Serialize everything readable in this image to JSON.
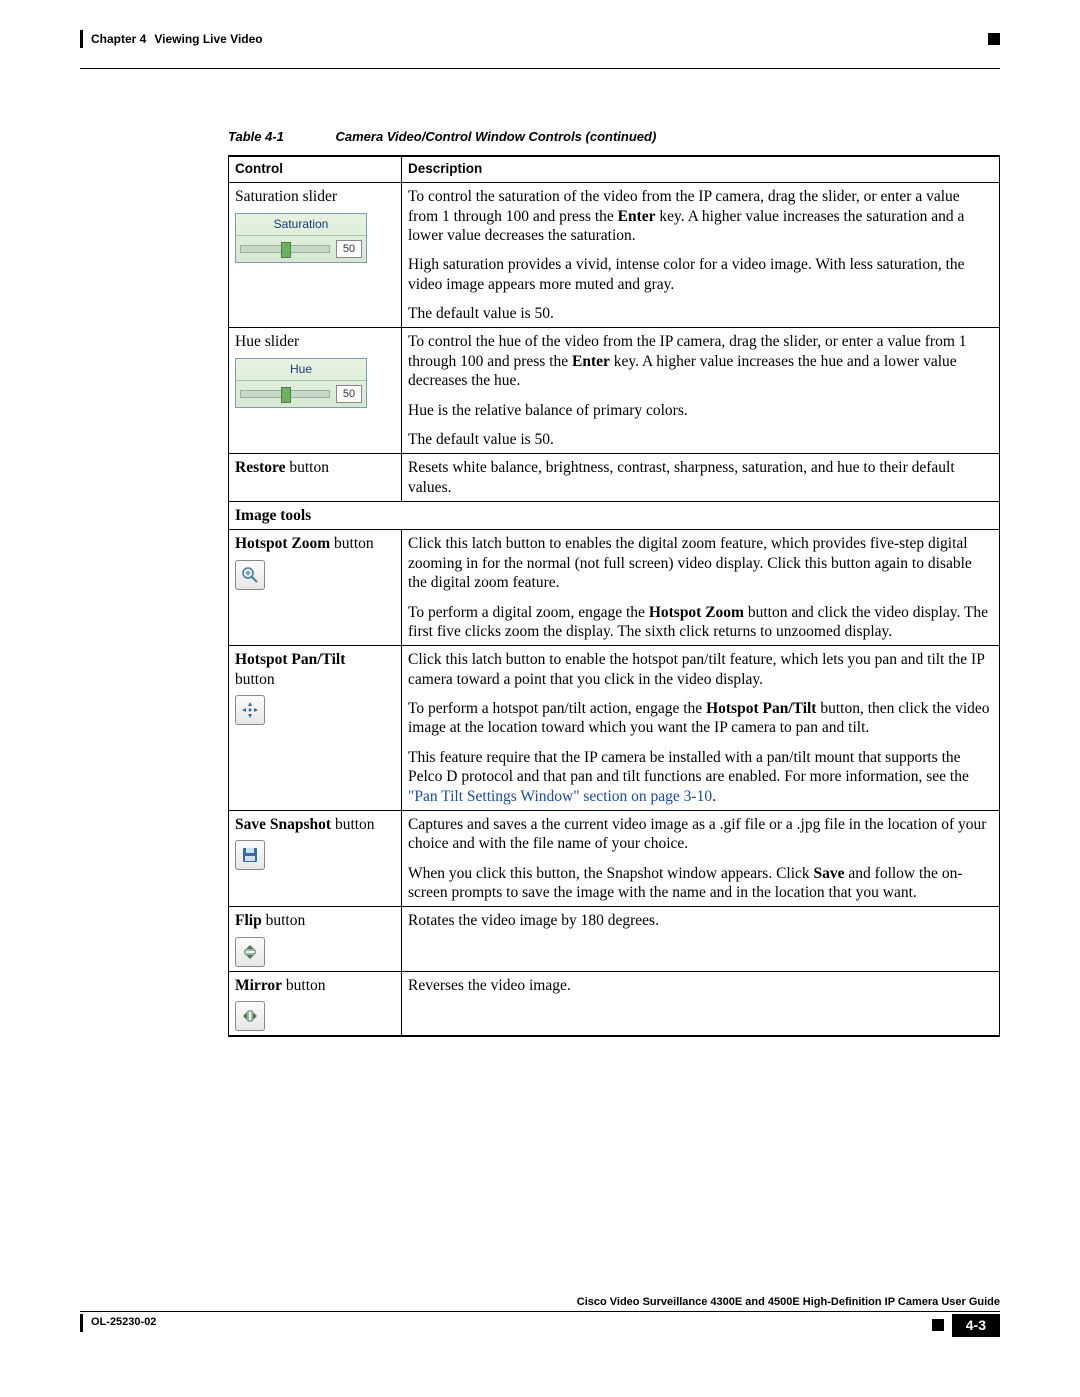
{
  "header": {
    "chapter": "Chapter 4",
    "title": "Viewing Live Video"
  },
  "table": {
    "caption_num": "Table 4-1",
    "caption_text": "Camera Video/Control Window Controls (continued)",
    "col1": "Control",
    "col2": "Description"
  },
  "rows": {
    "saturation": {
      "label": "Saturation slider",
      "widget_title": "Saturation",
      "widget_value": "50",
      "p1a": "To control the saturation of the video from the IP camera, drag the slider, or enter a value from 1 through 100 and press the ",
      "p1b": "Enter",
      "p1c": " key. A higher value increases the saturation and a lower value decreases the saturation.",
      "p2": "High saturation provides a vivid, intense color for a video image. With less saturation, the video image appears more muted and gray.",
      "p3": "The default value is 50."
    },
    "hue": {
      "label": "Hue slider",
      "widget_title": "Hue",
      "widget_value": "50",
      "p1a": "To control the hue of the video from the IP camera, drag the slider, or enter a value from 1 through 100 and press the ",
      "p1b": "Enter",
      "p1c": " key. A higher value increases the hue and a lower value decreases the hue.",
      "p2": "Hue is the relative balance of primary colors.",
      "p3": "The default value is 50."
    },
    "restore": {
      "label_b": "Restore",
      "label_r": " button",
      "p1": "Resets white balance, brightness, contrast, sharpness, saturation, and hue to their default values."
    },
    "section_image_tools": "Image tools",
    "hotspot_zoom": {
      "label_b": "Hotspot Zoom",
      "label_r": " button",
      "p1": "Click this latch button to enables the digital zoom feature, which provides five-step digital zooming in for the normal (not full screen) video display. Click this button again to disable the digital zoom feature.",
      "p2a": "To perform a digital zoom, engage the ",
      "p2b": "Hotspot Zoom",
      "p2c": " button and click the video display. The first five clicks zoom the display. The sixth click returns to unzoomed display."
    },
    "hotspot_pantilt": {
      "label_b": "Hotspot Pan/Tilt",
      "label_r": "button",
      "p1": "Click this latch button to enable the hotspot pan/tilt feature, which lets you pan and tilt the IP camera toward a point that you click in the video display.",
      "p2a": "To perform a hotspot pan/tilt action, engage the ",
      "p2b": "Hotspot Pan/Tilt",
      "p2c": " button, then click the video image at the location toward which you want the IP camera to pan and tilt.",
      "p3a": "This feature require that the IP camera be installed with a pan/tilt mount that supports the Pelco D protocol and that pan and tilt functions are enabled. For more information, see the ",
      "p3link": "\"Pan Tilt Settings Window\" section on page 3-10",
      "p3b": "."
    },
    "save_snapshot": {
      "label_b": "Save Snapshot",
      "label_r": " button",
      "p1": "Captures and saves a the current video image as a .gif file or a .jpg file in the location of your choice and with the file name of your choice.",
      "p2a": "When you click this button, the Snapshot window appears. Click ",
      "p2b": "Save",
      "p2c": " and follow the on-screen prompts to save the image with the name and in the location that you want."
    },
    "flip": {
      "label_b": "Flip",
      "label_r": " button",
      "p1": "Rotates the video image by 180 degrees."
    },
    "mirror": {
      "label_b": "Mirror",
      "label_r": " button",
      "p1": "Reverses the video image."
    }
  },
  "footer": {
    "guide": "Cisco Video Surveillance 4300E and 4500E High-Definition IP Camera User Guide",
    "doc": "OL-25230-02",
    "page": "4-3"
  }
}
